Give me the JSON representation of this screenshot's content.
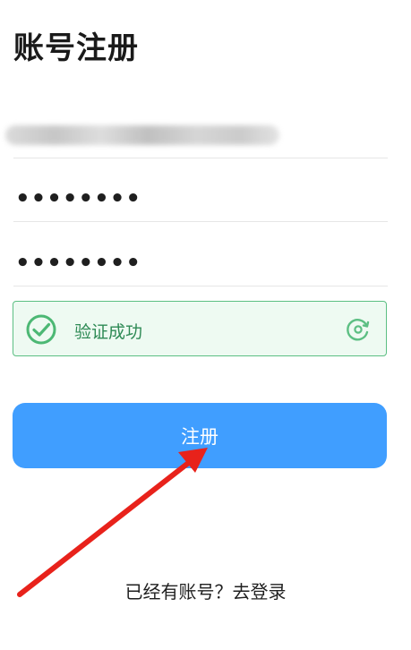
{
  "page": {
    "title": "账号注册"
  },
  "form": {
    "password": "••••••••",
    "confirm_password": "••••••••"
  },
  "verify": {
    "status_text": "验证成功",
    "color": "#5cbf83"
  },
  "register": {
    "button_label": "注册",
    "color": "#409eff"
  },
  "footer": {
    "prompt": "已经有账号？",
    "login_link": "去登录"
  },
  "annotation": {
    "arrow_color": "#e8221b"
  }
}
